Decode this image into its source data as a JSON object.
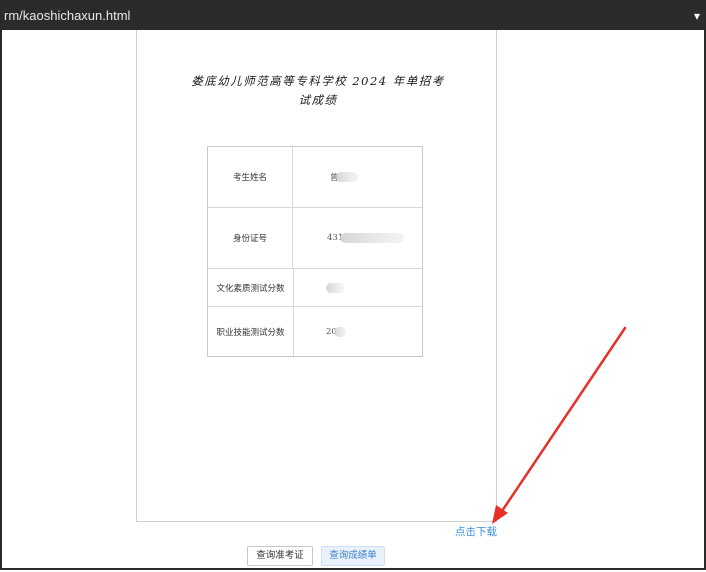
{
  "browser": {
    "url_text": "rm/kaoshichaxun.html",
    "tray_icon": "chevron-icon"
  },
  "document": {
    "title": "娄底幼儿师范高等专科学校 2024 年单招考试成绩",
    "fields": [
      {
        "label": "考生姓名",
        "value": "曾"
      },
      {
        "label": "身份证号",
        "value": "431"
      },
      {
        "label": "文化素质测试分数",
        "value": ""
      },
      {
        "label": "职业技能测试分数",
        "value": "20"
      }
    ]
  },
  "actions": {
    "download_label": "点击下载",
    "ticket_button": "查询准考证",
    "score_button": "查询成绩单"
  },
  "colors": {
    "link": "#3d8fe0",
    "annotation_arrow": "#e8302a",
    "active_button_bg": "#e9f2fc"
  }
}
